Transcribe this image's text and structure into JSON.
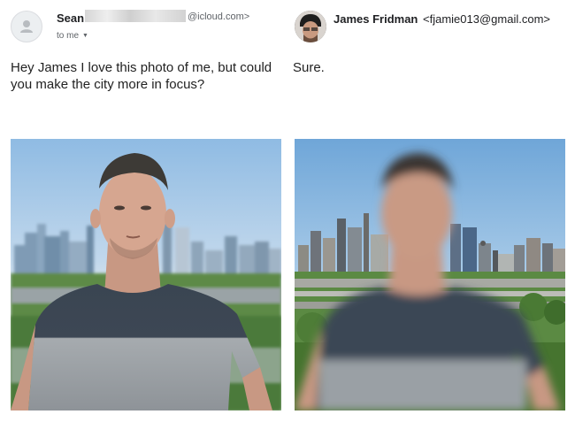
{
  "left_email": {
    "sender_name": "Sean",
    "sender_domain": "@icloud.com>",
    "recipient_line": "to me",
    "avatar_icon": "person-icon",
    "expand_icon": "caret-down-icon",
    "body": "Hey James I love this photo of me, but could you make the city more in focus?"
  },
  "right_email": {
    "sender_name": "James Fridman",
    "sender_email": "<fjamie013@gmail.com>",
    "body": "Sure."
  },
  "colors": {
    "shirt_dark": "#3b4654",
    "shirt_light": "#9aa0a5",
    "sky": "#a9cbe8",
    "greenery": "#4f7f3e"
  }
}
